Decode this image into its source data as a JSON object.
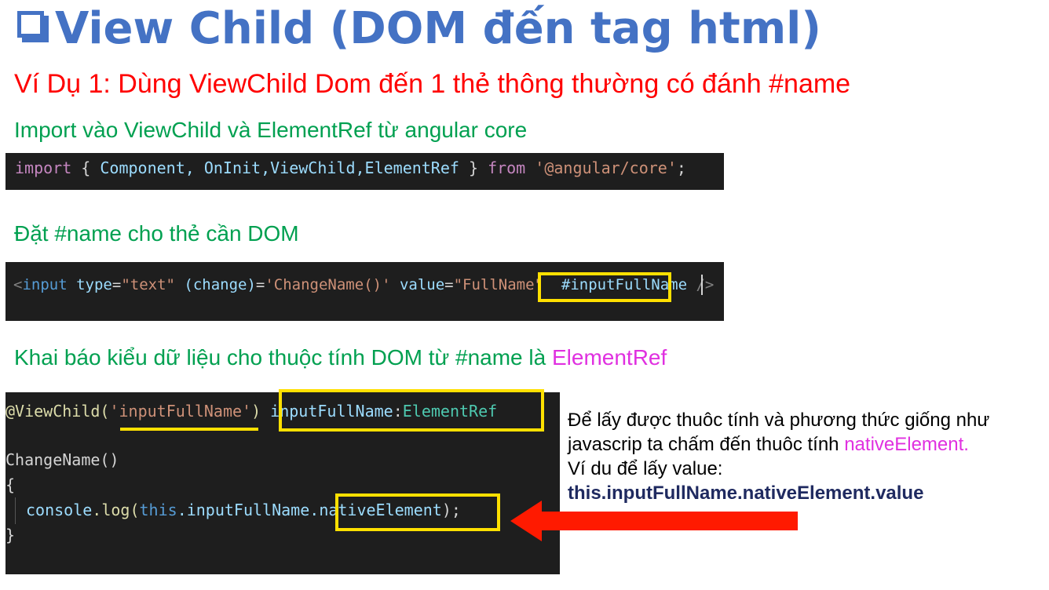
{
  "title": "View Child (DOM đến tag html)",
  "heading_red": "Ví Dụ 1: Dùng ViewChild Dom đến 1 thẻ thông thường có đánh #name",
  "step1": "Import vào ViewChild và ElementRef từ angular core",
  "code1": {
    "kw_import": "import",
    "brace_open": " { ",
    "items": "Component, OnInit,ViewChild,ElementRef",
    "brace_close": " } ",
    "kw_from": "from",
    "module": " '@angular/core'",
    "semi": ";"
  },
  "step2": "Đặt #name cho thẻ cần DOM",
  "code2": {
    "open": "<",
    "tag": "input",
    "attr_type": " type",
    "eq1": "=",
    "val_type": "\"text\"",
    "attr_change": " (change)",
    "eq2": "=",
    "val_change": "'ChangeName()'",
    "attr_value": " value",
    "eq3": "=",
    "val_value": "\"FullName\"",
    "ref": "#inputFullName",
    "close": " />"
  },
  "step3_prefix": "Khai báo kiểu dữ liệu cho thuộc tính DOM từ #name là ",
  "step3_highlight": "ElementRef",
  "code3": {
    "decorator": "@ViewChild(",
    "arg": "'inputFullName'",
    "paren": ")",
    "prop": " inputFullName",
    "colon": ":",
    "type": "ElementRef",
    "method": "ChangeName()",
    "brace_open": "{",
    "console": "console",
    "log": ".log(",
    "this_kw": "this",
    "member": ".inputFullName.",
    "native": "nativeElement",
    "end": ");",
    "brace_close": "}"
  },
  "description": {
    "line1": "Để lấy được thuôc tính và phương thức giống như",
    "line2_prefix": "javascrip ta chấm đến thuôc tính ",
    "line2_highlight": "nativeElement.",
    "line3": "Ví du để lấy value:",
    "line4": "this.inputFullName.nativeElement.value"
  },
  "colors": {
    "title": "#4472c4",
    "red_heading": "#ff0000",
    "green_text": "#00a050",
    "highlight_box": "#ffe000",
    "arrow": "#ff1a00"
  }
}
